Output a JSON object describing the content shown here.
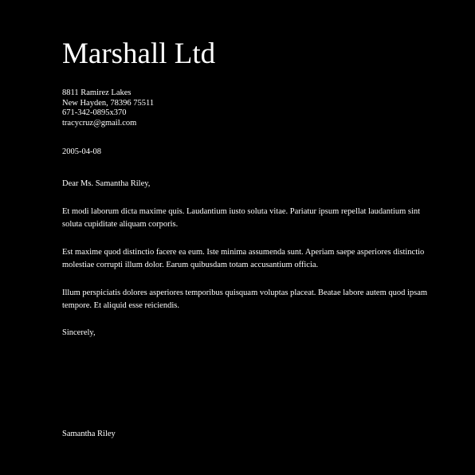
{
  "letterhead": {
    "company": "Marshall Ltd",
    "address_line1": "8811 Ramirez Lakes",
    "address_line2": "New Hayden, 78396 75511",
    "phone": "671-342-0895x370",
    "email": "tracycruz@gmail.com"
  },
  "letter": {
    "date": "2005-04-08",
    "salutation": "Dear Ms. Samantha Riley,",
    "paragraphs": [
      "Et modi laborum dicta maxime quis. Laudantium iusto soluta vitae. Pariatur ipsum repellat laudantium sint soluta cupiditate aliquam corporis.",
      "Est maxime quod distinctio facere ea eum. Iste minima assumenda sunt. Aperiam saepe asperiores distinctio molestiae corrupti illum dolor. Earum quibusdam totam accusantium officia.",
      "Illum perspiciatis dolores asperiores temporibus quisquam voluptas placeat. Beatae labore autem quod ipsam tempore. Et aliquid esse reiciendis."
    ],
    "closing": "Sincerely,",
    "signature": "Samantha Riley"
  },
  "colors": {
    "background": "#000000",
    "text": "#ffffff"
  }
}
